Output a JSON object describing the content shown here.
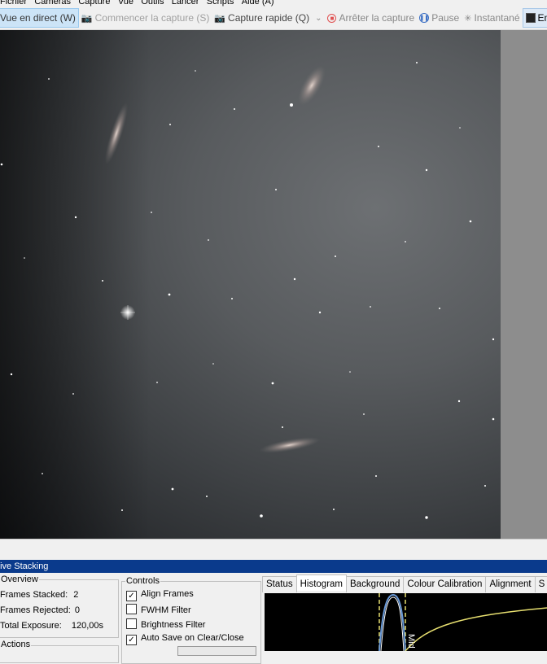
{
  "menu": [
    "Fichier",
    "Caméras",
    "Capture",
    "Vue",
    "Outils",
    "Lancer",
    "Scripts",
    "Aide (A)"
  ],
  "toolbar": {
    "live_view": "Vue en direct (W)",
    "start_capture": "Commencer la capture (S)",
    "quick_capture": "Capture rapide (Q)",
    "dropdown": "⌄",
    "stop_capture": "Arrêter la capture",
    "pause": "Pause",
    "snapshot": "Instantané",
    "stacking": "Empileme"
  },
  "stacking_panel": {
    "title": "Live Stacking",
    "overview": {
      "title": "Overview",
      "frames_stacked_label": "Frames Stacked:",
      "frames_stacked_value": "2",
      "frames_rejected_label": "Frames Rejected:",
      "frames_rejected_value": "0",
      "total_exposure_label": "Total Exposure:",
      "total_exposure_value": "120,00s"
    },
    "actions_title": "Actions",
    "controls": {
      "title": "Controls",
      "items": [
        {
          "label": "Align Frames",
          "checked": true
        },
        {
          "label": "FWHM Filter",
          "checked": false
        },
        {
          "label": "Brightness Filter",
          "checked": false
        },
        {
          "label": "Auto Save on Clear/Close",
          "checked": true
        }
      ]
    },
    "tabs": [
      "Status",
      "Histogram",
      "Background",
      "Colour Calibration",
      "Alignment",
      "S"
    ],
    "active_tab": "Histogram",
    "histogram_marker": "Mid"
  },
  "colors": {
    "stacking_bar": "#0a3a8c",
    "toolbar_active": "#cce4f7",
    "histogram_bg": "#000000",
    "histogram_curve": "#e8e070",
    "histogram_marker": "#ffffff"
  }
}
